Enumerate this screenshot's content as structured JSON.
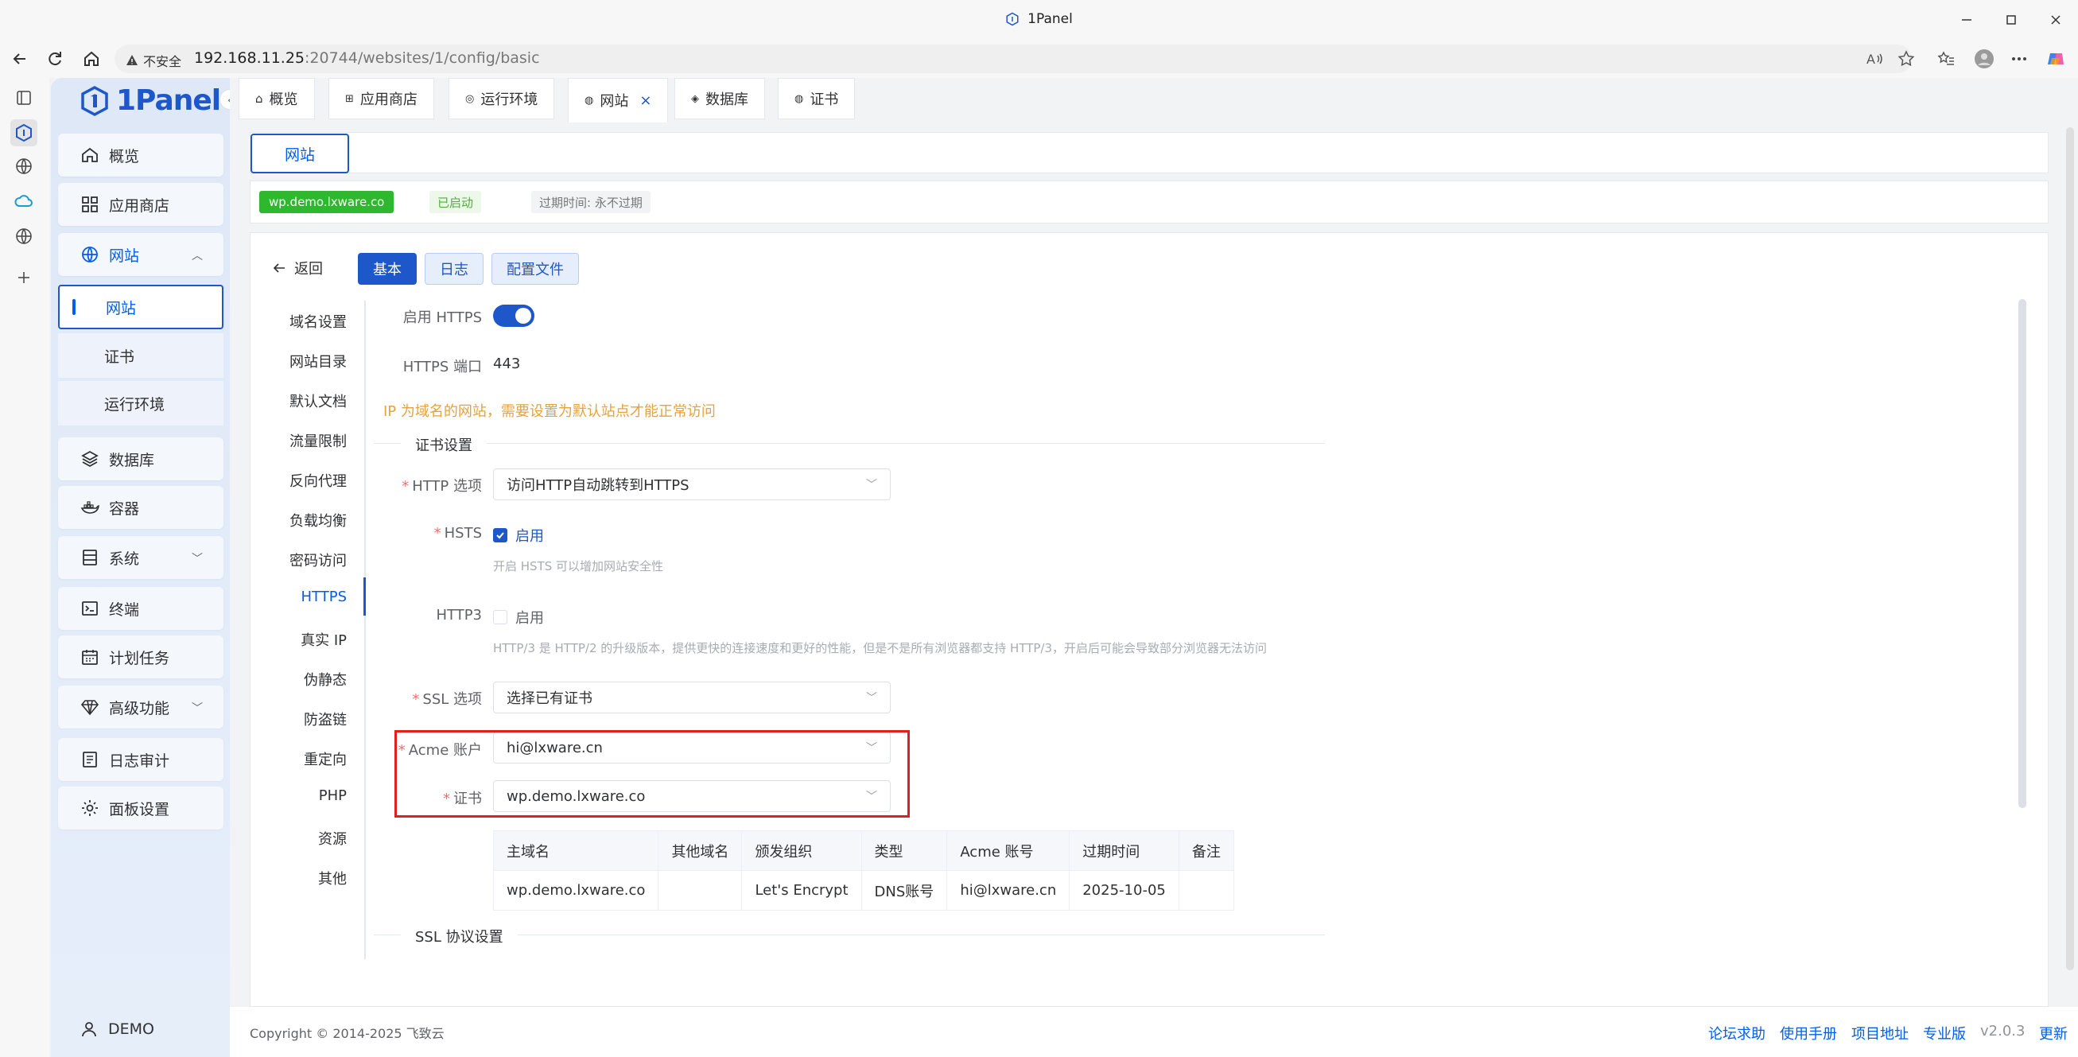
{
  "browser": {
    "window_title": "1Panel",
    "security_label": "不安全",
    "url_host": "192.168.11.25",
    "url_rest": ":20744/websites/1/config/basic"
  },
  "app": {
    "logo_text": "1Panel",
    "user": "DEMO"
  },
  "sidebar": {
    "items": [
      {
        "label": "概览",
        "icon": "home-icon"
      },
      {
        "label": "应用商店",
        "icon": "grid-icon"
      },
      {
        "label": "网站",
        "icon": "globe-icon",
        "expanded": true
      },
      {
        "label": "数据库",
        "icon": "layers-icon"
      },
      {
        "label": "容器",
        "icon": "docker-icon"
      },
      {
        "label": "系统",
        "icon": "server-icon"
      },
      {
        "label": "终端",
        "icon": "terminal-icon"
      },
      {
        "label": "计划任务",
        "icon": "calendar-icon"
      },
      {
        "label": "高级功能",
        "icon": "diamond-icon"
      },
      {
        "label": "日志审计",
        "icon": "log-icon"
      },
      {
        "label": "面板设置",
        "icon": "gear-icon"
      }
    ],
    "sub_items": [
      "网站",
      "证书",
      "运行环境"
    ]
  },
  "tabs": [
    {
      "label": "概览"
    },
    {
      "label": "应用商店"
    },
    {
      "label": "运行环境"
    },
    {
      "label": "网站",
      "active": true
    },
    {
      "label": "数据库"
    },
    {
      "label": "证书"
    }
  ],
  "site": {
    "header_tab": "网站",
    "domain_tag": "wp.demo.lxware.co",
    "status": "已启动",
    "expire": "过期时间: 永不过期"
  },
  "toolbar": {
    "back": "返回",
    "basic": "基本",
    "log": "日志",
    "config": "配置文件"
  },
  "menu": [
    "域名设置",
    "网站目录",
    "默认文档",
    "流量限制",
    "反向代理",
    "负载均衡",
    "密码访问",
    "HTTPS",
    "真实 IP",
    "伪静态",
    "防盗链",
    "重定向",
    "PHP",
    "资源",
    "其他"
  ],
  "form": {
    "enable_https_label": "启用 HTTPS",
    "https_port_label": "HTTPS 端口",
    "https_port_value": "443",
    "ip_warning": "IP 为域名的网站，需要设置为默认站点才能正常访问",
    "cert_section": "证书设置",
    "http_option_label": "HTTP 选项",
    "http_option_value": "访问HTTP自动跳转到HTTPS",
    "hsts_label": "HSTS",
    "hsts_check": "启用",
    "hsts_help": "开启 HSTS 可以增加网站安全性",
    "http3_label": "HTTP3",
    "http3_check": "启用",
    "http3_help": "HTTP/3 是 HTTP/2 的升级版本，提供更快的连接速度和更好的性能，但是不是所有浏览器都支持 HTTP/3，开启后可能会导致部分浏览器无法访问",
    "ssl_option_label": "SSL 选项",
    "ssl_option_value": "选择已有证书",
    "acme_label": "Acme 账户",
    "acme_value": "hi@lxware.cn",
    "cert_label": "证书",
    "cert_value": "wp.demo.lxware.co",
    "ssl_protocol_section": "SSL 协议设置"
  },
  "cert_table": {
    "headers": [
      "主域名",
      "其他域名",
      "颁发组织",
      "类型",
      "Acme 账号",
      "过期时间",
      "备注"
    ],
    "row": [
      "wp.demo.lxware.co",
      "",
      "Let's Encrypt",
      "DNS账号",
      "hi@lxware.cn",
      "2025-10-05",
      ""
    ]
  },
  "footer": {
    "copyright": "Copyright © 2014-2025 飞致云",
    "links": [
      "论坛求助",
      "使用手册",
      "项目地址",
      "专业版"
    ],
    "version": "v2.0.3",
    "update": "更新"
  },
  "colors": {
    "primary": "#1d57c9",
    "success": "#2eb82e",
    "warning": "#e6a23c",
    "highlight": "#e02020"
  }
}
